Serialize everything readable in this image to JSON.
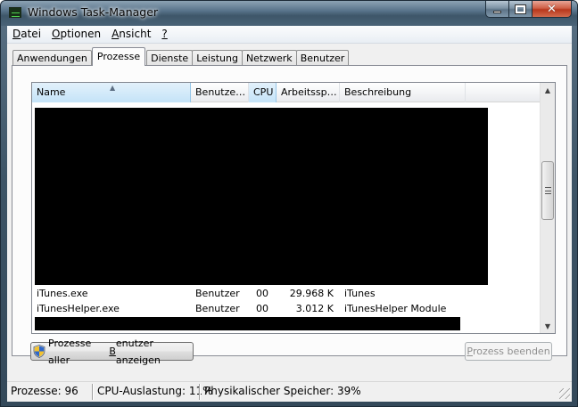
{
  "window": {
    "title": "Windows Task-Manager"
  },
  "menu": [
    {
      "underline": "D",
      "rest": "atei"
    },
    {
      "underline": "O",
      "rest": "ptionen"
    },
    {
      "underline": "A",
      "rest": "nsicht"
    },
    {
      "underline": "?",
      "rest": ""
    }
  ],
  "tabs": [
    "Anwendungen",
    "Prozesse",
    "Dienste",
    "Leistung",
    "Netzwerk",
    "Benutzer"
  ],
  "active_tab": "Prozesse",
  "columns": [
    "Name",
    "Benutze…",
    "CPU",
    "Arbeitssp…",
    "Beschreibung"
  ],
  "processes": [
    {
      "name": "iTunes.exe",
      "user": "Benutzer",
      "cpu": "00",
      "memory": "29.968 K",
      "description": "iTunes"
    },
    {
      "name": "iTunesHelper.exe",
      "user": "Benutzer",
      "cpu": "00",
      "memory": "3.012 K",
      "description": "iTunesHelper Module"
    }
  ],
  "buttons": {
    "show_all_pre": "Prozesse aller ",
    "show_all_ul": "B",
    "show_all_post": "enutzer anzeigen",
    "end_process_pre": "",
    "end_process_ul": "P",
    "end_process_post": "rozess beenden"
  },
  "status": {
    "processes": "Prozesse: 96",
    "cpu": "CPU-Auslastung: 11%",
    "memory": "Physikalischer Speicher: 39%"
  },
  "colors": {
    "titlebar": "#4a6377",
    "close": "#c8452a",
    "selected_column": "#c4e3f8"
  }
}
